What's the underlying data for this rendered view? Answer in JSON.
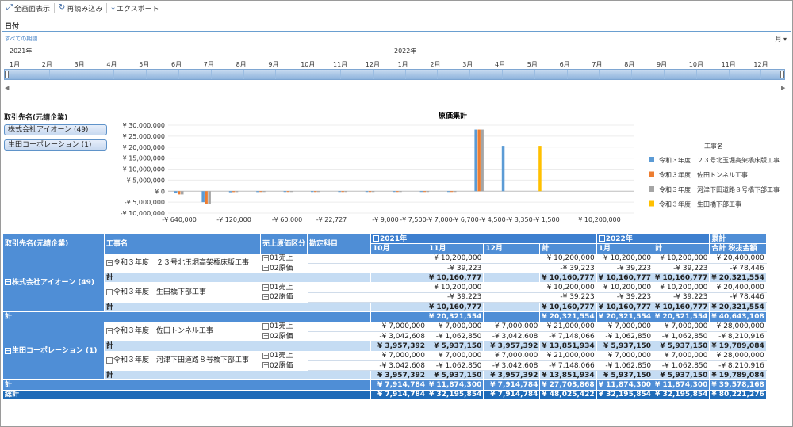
{
  "toolbar": {
    "fullscreen": "全画面表示",
    "reload": "再読み込み",
    "export": "エクスポート"
  },
  "date_filter": {
    "title": "日付",
    "all_periods": "すべての期間",
    "unit": "月",
    "years": [
      "2021年",
      "2022年"
    ],
    "months": [
      "1月",
      "2月",
      "3月",
      "4月",
      "5月",
      "6月",
      "7月",
      "8月",
      "9月",
      "10月",
      "11月",
      "12月",
      "1月",
      "2月",
      "3月",
      "4月",
      "5月",
      "6月",
      "7月",
      "8月",
      "9月",
      "10月",
      "11月",
      "12月"
    ]
  },
  "client_filter": {
    "title": "取引先名(元請企業)",
    "items": [
      "株式会社アイオーン (49)",
      "生田コーポレーション (1)"
    ]
  },
  "chart_data": {
    "type": "bar",
    "title": "原価集計",
    "legend_title": "工事名",
    "y_ticks": [
      "¥ 30,000,000",
      "¥ 25,000,000",
      "¥ 20,000,000",
      "¥ 15,000,000",
      "¥ 10,000,000",
      "¥ 5,000,000",
      "¥ 0",
      "-¥ 5,000,000",
      "-¥ 10,000,000"
    ],
    "ylim": [
      -10000000,
      30000000
    ],
    "x_labels": [
      "-¥ 640,000",
      "-¥ 120,000",
      "-¥ 60,000",
      "-¥ 22,727",
      "-¥ 9,000",
      "-¥ 7,500",
      "-¥ 7,000",
      "-¥ 6,700",
      "-¥ 4,500",
      "-¥ 3,350",
      "-¥ 1,500",
      "¥ 10,200,000"
    ],
    "series": [
      {
        "name": "令和３年度　２３号北玉堀高架橋床版工事",
        "color": "#5b9bd5",
        "values": [
          -1000000,
          -5000000,
          -500000,
          -400000,
          -150000,
          -200000,
          -150000,
          -200000,
          -150000,
          -150000,
          -150000,
          28000000,
          20600000,
          0
        ]
      },
      {
        "name": "令和３年度　佐田トンネル工事",
        "color": "#ed7d31",
        "values": [
          -1500000,
          -6000000,
          -400000,
          -300000,
          -300000,
          -300000,
          -250000,
          -200000,
          -200000,
          -200000,
          -150000,
          28000000,
          0,
          0
        ]
      },
      {
        "name": "令和３年度　河津下田道路８号橋下部工事",
        "color": "#a5a5a5",
        "values": [
          -1500000,
          -6000000,
          -400000,
          -300000,
          -300000,
          -300000,
          -250000,
          -200000,
          -200000,
          -200000,
          -150000,
          28000000,
          0,
          0
        ]
      },
      {
        "name": "令和３年度　生田橋下部工事",
        "color": "#ffc000",
        "values": [
          0,
          0,
          0,
          0,
          0,
          0,
          0,
          0,
          0,
          0,
          0,
          0,
          0,
          20600000
        ]
      }
    ]
  },
  "pivot": {
    "headers": {
      "client": "取引先名(元請企業)",
      "project": "工事名",
      "category": "売上原価区分",
      "account": "勘定科目",
      "y2021": "2021年",
      "y2022": "2022年",
      "cum": "累計",
      "m10": "10月",
      "m11": "11月",
      "m12": "12月",
      "total": "計",
      "m1": "1月",
      "cum_total": "合計 税抜金額"
    },
    "clients": [
      {
        "name": "株式会社アイオーン (49)",
        "projects": [
          {
            "name": "令和３年度　２３号北玉堀高架橋床版工事",
            "rows": [
              {
                "cat": "01売上",
                "v": [
                  "",
                  "¥ 10,200,000",
                  "",
                  "¥ 10,200,000",
                  "¥ 10,200,000",
                  "¥ 10,200,000",
                  "¥ 20,400,000"
                ]
              },
              {
                "cat": "02原価",
                "v": [
                  "",
                  "-¥ 39,223",
                  "",
                  "-¥ 39,223",
                  "-¥ 39,223",
                  "-¥ 39,223",
                  "-¥ 78,446"
                ]
              }
            ],
            "total": [
              "",
              "¥ 10,160,777",
              "",
              "¥ 10,160,777",
              "¥ 10,160,777",
              "¥ 10,160,777",
              "¥ 20,321,554"
            ]
          },
          {
            "name": "令和３年度　生田橋下部工事",
            "rows": [
              {
                "cat": "01売上",
                "v": [
                  "",
                  "¥ 10,200,000",
                  "",
                  "¥ 10,200,000",
                  "¥ 10,200,000",
                  "¥ 10,200,000",
                  "¥ 20,400,000"
                ]
              },
              {
                "cat": "02原価",
                "v": [
                  "",
                  "-¥ 39,223",
                  "",
                  "-¥ 39,223",
                  "-¥ 39,223",
                  "-¥ 39,223",
                  "-¥ 78,446"
                ]
              }
            ],
            "total": [
              "",
              "¥ 10,160,777",
              "",
              "¥ 10,160,777",
              "¥ 10,160,777",
              "¥ 10,160,777",
              "¥ 20,321,554"
            ]
          }
        ],
        "total": [
          "",
          "¥ 20,321,554",
          "",
          "¥ 20,321,554",
          "¥ 20,321,554",
          "¥ 20,321,554",
          "¥ 40,643,108"
        ]
      },
      {
        "name": "生田コーポレーション (1)",
        "projects": [
          {
            "name": "令和３年度　佐田トンネル工事",
            "rows": [
              {
                "cat": "01売上",
                "v": [
                  "¥ 7,000,000",
                  "¥ 7,000,000",
                  "¥ 7,000,000",
                  "¥ 21,000,000",
                  "¥ 7,000,000",
                  "¥ 7,000,000",
                  "¥ 28,000,000"
                ]
              },
              {
                "cat": "02原価",
                "v": [
                  "-¥ 3,042,608",
                  "-¥ 1,062,850",
                  "-¥ 3,042,608",
                  "-¥ 7,148,066",
                  "-¥ 1,062,850",
                  "-¥ 1,062,850",
                  "-¥ 8,210,916"
                ]
              }
            ],
            "total": [
              "¥ 3,957,392",
              "¥ 5,937,150",
              "¥ 3,957,392",
              "¥ 13,851,934",
              "¥ 5,937,150",
              "¥ 5,937,150",
              "¥ 19,789,084"
            ]
          },
          {
            "name": "令和３年度　河津下田道路８号橋下部工事",
            "rows": [
              {
                "cat": "01売上",
                "v": [
                  "¥ 7,000,000",
                  "¥ 7,000,000",
                  "¥ 7,000,000",
                  "¥ 21,000,000",
                  "¥ 7,000,000",
                  "¥ 7,000,000",
                  "¥ 28,000,000"
                ]
              },
              {
                "cat": "02原価",
                "v": [
                  "-¥ 3,042,608",
                  "-¥ 1,062,850",
                  "-¥ 3,042,608",
                  "-¥ 7,148,066",
                  "-¥ 1,062,850",
                  "-¥ 1,062,850",
                  "-¥ 8,210,916"
                ]
              }
            ],
            "total": [
              "¥ 3,957,392",
              "¥ 5,937,150",
              "¥ 3,957,392",
              "¥ 13,851,934",
              "¥ 5,937,150",
              "¥ 5,937,150",
              "¥ 19,789,084"
            ]
          }
        ],
        "total": [
          "¥ 7,914,784",
          "¥ 11,874,300",
          "¥ 7,914,784",
          "¥ 27,703,868",
          "¥ 11,874,300",
          "¥ 11,874,300",
          "¥ 39,578,168"
        ]
      }
    ],
    "subtotal_label": "計",
    "grand_label": "総計",
    "grand": [
      "¥ 7,914,784",
      "¥ 32,195,854",
      "¥ 7,914,784",
      "¥ 48,025,422",
      "¥ 32,195,854",
      "¥ 32,195,854",
      "¥ 80,221,276"
    ]
  }
}
